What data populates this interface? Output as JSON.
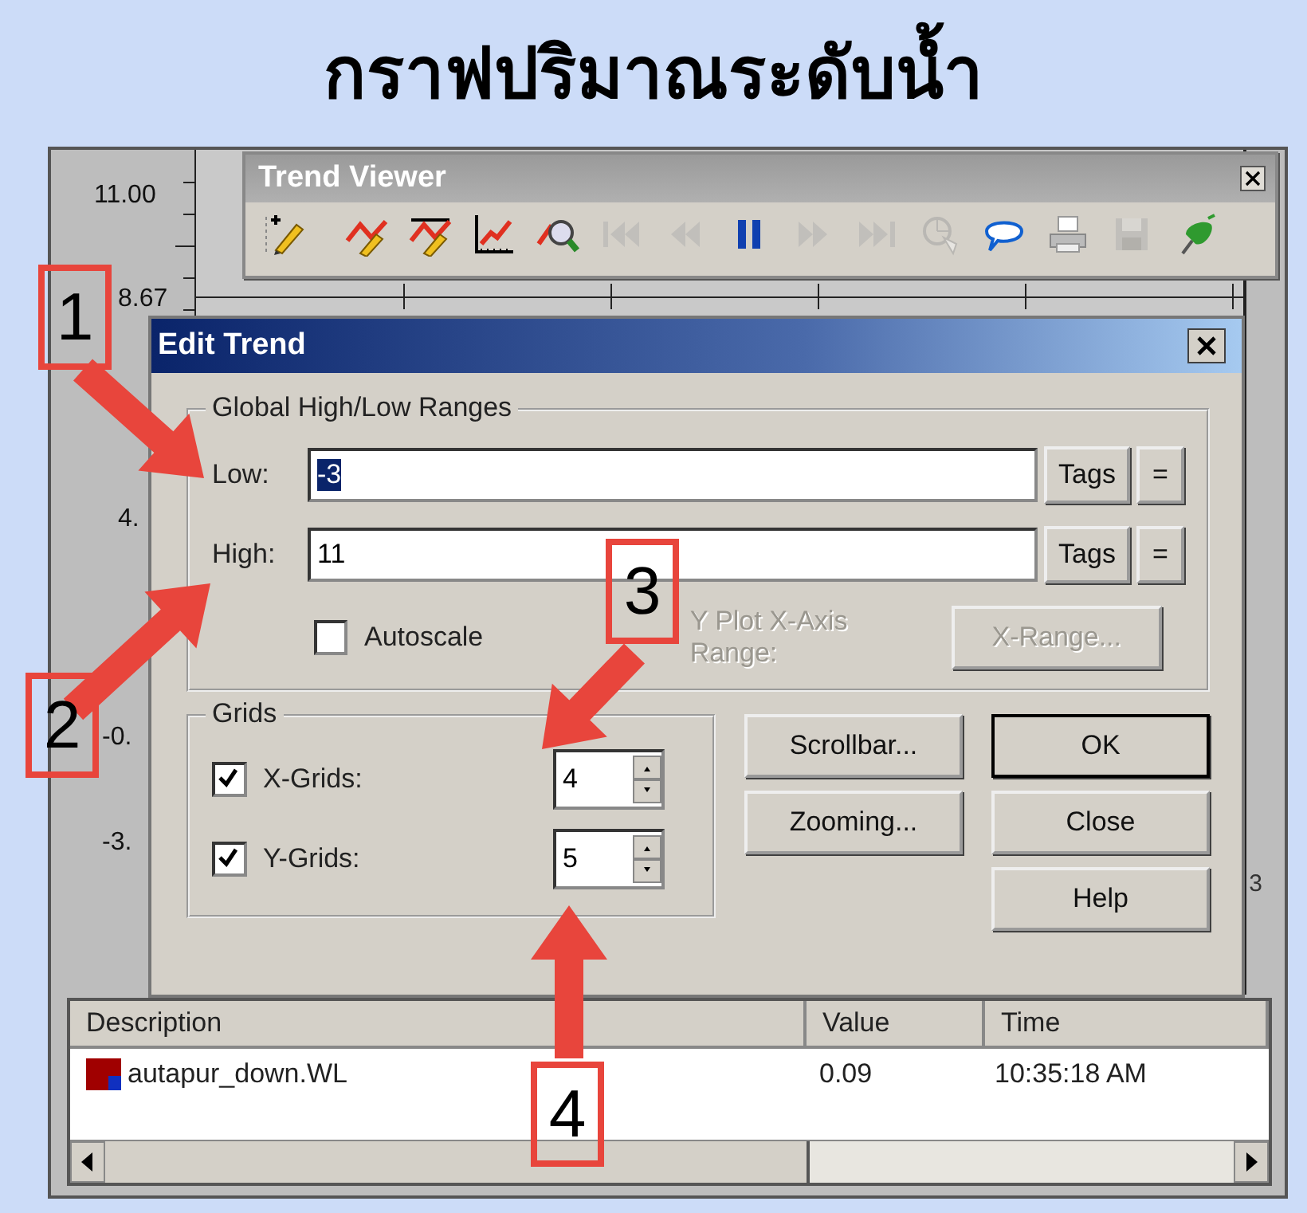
{
  "page_title": "กราฟปริมาณระดับน้ำ",
  "chart": {
    "y_labels": [
      "11.00",
      "8.67",
      "4.",
      "-0.",
      "-3."
    ],
    "x_fragment": "3"
  },
  "toolbar": {
    "title": "Trend Viewer",
    "buttons": [
      {
        "kind": "add",
        "disabled": false
      },
      {
        "kind": "edit",
        "disabled": false
      },
      {
        "kind": "edit-limits",
        "disabled": false
      },
      {
        "kind": "chart",
        "disabled": false
      },
      {
        "kind": "search",
        "disabled": false
      },
      {
        "kind": "first",
        "disabled": true
      },
      {
        "kind": "back",
        "disabled": true
      },
      {
        "kind": "pause",
        "disabled": false
      },
      {
        "kind": "forward",
        "disabled": true
      },
      {
        "kind": "last",
        "disabled": true
      },
      {
        "kind": "zoom",
        "disabled": true
      },
      {
        "kind": "comment",
        "disabled": false
      },
      {
        "kind": "print",
        "disabled": false
      },
      {
        "kind": "save",
        "disabled": true
      },
      {
        "kind": "pin",
        "disabled": false
      }
    ]
  },
  "dialog": {
    "title": "Edit Trend",
    "ranges": {
      "legend": "Global High/Low Ranges",
      "fields": [
        {
          "label": "Low:",
          "value": "-3",
          "selected": true,
          "tags": "Tags",
          "equals": "="
        },
        {
          "label": "High:",
          "value": "11",
          "selected": false,
          "tags": "Tags",
          "equals": "="
        }
      ],
      "autoscale": {
        "label": "Autoscale",
        "checked": false
      },
      "xy_label": "Y Plot X-Axis Range:",
      "xrange_button": "X-Range...",
      "disabled": true
    },
    "grids": {
      "legend": "Grids",
      "rows": [
        {
          "label": "X-Grids:",
          "checked": true,
          "value": "4"
        },
        {
          "label": "Y-Grids:",
          "checked": true,
          "value": "5"
        }
      ]
    },
    "side_buttons": [
      "Scrollbar...",
      "Zooming..."
    ],
    "action_buttons": [
      {
        "label": "OK",
        "default": true
      },
      {
        "label": "Close",
        "default": false
      },
      {
        "label": "Help",
        "default": false
      }
    ]
  },
  "legend_table": {
    "columns": [
      "Description",
      "Value",
      "Time"
    ],
    "rows": [
      {
        "color": "#a00000",
        "cells": [
          "autapur_down.WL",
          "0.09",
          "10:35:18  AM"
        ]
      }
    ]
  },
  "annotations": [
    {
      "number": "1"
    },
    {
      "number": "2"
    },
    {
      "number": "3"
    },
    {
      "number": "4"
    }
  ]
}
